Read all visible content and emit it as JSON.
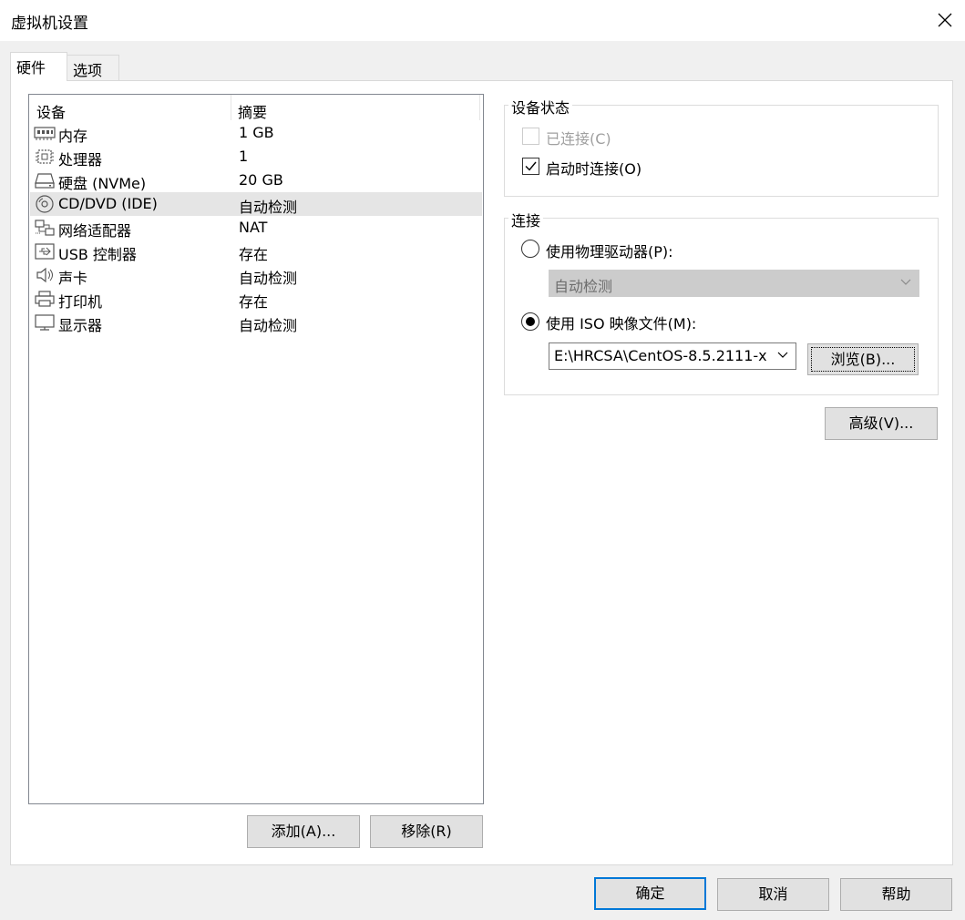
{
  "window": {
    "title": "虚拟机设置"
  },
  "tabs": [
    {
      "label": "硬件",
      "active": true
    },
    {
      "label": "选项",
      "active": false
    }
  ],
  "device_list": {
    "columns": [
      "设备",
      "摘要"
    ],
    "rows": [
      {
        "name": "内存",
        "summary": "1 GB",
        "icon": "memory-icon"
      },
      {
        "name": "处理器",
        "summary": "1",
        "icon": "processor-icon"
      },
      {
        "name": "硬盘 (NVMe)",
        "summary": "20 GB",
        "icon": "hard-disk-icon"
      },
      {
        "name": "CD/DVD (IDE)",
        "summary": "自动检测",
        "icon": "cd-dvd-icon",
        "selected": true
      },
      {
        "name": "网络适配器",
        "summary": "NAT",
        "icon": "network-adapter-icon"
      },
      {
        "name": "USB 控制器",
        "summary": "存在",
        "icon": "usb-icon"
      },
      {
        "name": "声卡",
        "summary": "自动检测",
        "icon": "sound-card-icon"
      },
      {
        "name": "打印机",
        "summary": "存在",
        "icon": "printer-icon"
      },
      {
        "name": "显示器",
        "summary": "自动检测",
        "icon": "display-icon"
      }
    ]
  },
  "list_buttons": {
    "add": "添加(A)...",
    "remove": "移除(R)"
  },
  "device_status": {
    "label": "设备状态",
    "connected": {
      "label": "已连接(C)",
      "checked": false,
      "disabled": true
    },
    "connect_at_power_on": {
      "label": "启动时连接(O)",
      "checked": true
    }
  },
  "connection": {
    "label": "连接",
    "physical_drive": {
      "label": "使用物理驱动器(P):",
      "selected": false,
      "value": "自动检测"
    },
    "iso_image": {
      "label": "使用 ISO 映像文件(M):",
      "selected": true,
      "value": "E:\\HRCSA\\CentOS-8.5.2111-x"
    },
    "browse": "浏览(B)..."
  },
  "advanced": "高级(V)...",
  "footer": {
    "ok": "确定",
    "cancel": "取消",
    "help": "帮助"
  },
  "colors": {
    "accent": "#0078d7",
    "selected_row": "#e5e5e5",
    "button_face": "#e1e1e1"
  }
}
